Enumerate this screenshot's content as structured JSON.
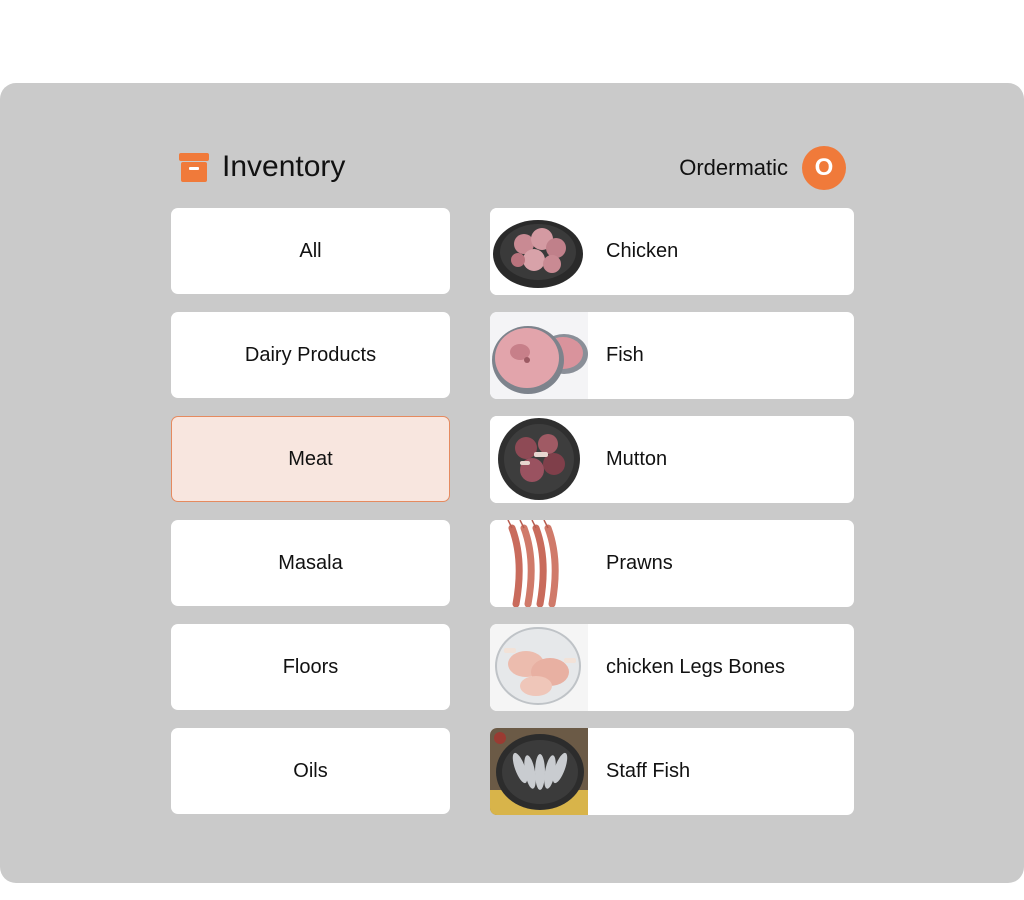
{
  "header": {
    "title": "Inventory",
    "user_name": "Ordermatic",
    "avatar_letter": "O",
    "accent_color": "#f07a3a"
  },
  "categories": [
    {
      "label": "All"
    },
    {
      "label": "Dairy Products"
    },
    {
      "label": "Meat",
      "selected": true
    },
    {
      "label": "Masala"
    },
    {
      "label": "Floors"
    },
    {
      "label": "Oils"
    }
  ],
  "items": [
    {
      "label": "Chicken",
      "image": "chicken-photo"
    },
    {
      "label": "Fish",
      "image": "fish-photo"
    },
    {
      "label": "Mutton",
      "image": "mutton-photo"
    },
    {
      "label": "Prawns",
      "image": "prawns-photo"
    },
    {
      "label": "chicken Legs Bones",
      "image": "chicken-legs-photo"
    },
    {
      "label": "Staff Fish",
      "image": "staff-fish-photo"
    }
  ]
}
